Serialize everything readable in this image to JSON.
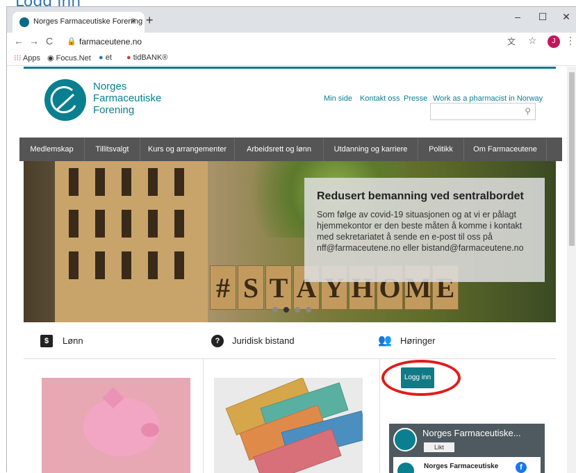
{
  "top_heading": "Logg inn",
  "browser": {
    "tab_title": "Norges Farmaceutiske Forening",
    "tab_close": "×",
    "new_tab": "+",
    "min": "–",
    "max": "☐",
    "close": "✕",
    "url": "farmaceutene.no",
    "profile_initial": "J",
    "bookmarks": [
      {
        "label": "Apps",
        "icon": "apps-grid-icon"
      },
      {
        "label": "Focus.Net",
        "icon": "globe-icon"
      },
      {
        "label": "et",
        "icon": "et-icon"
      },
      {
        "label": "tidBANK®",
        "icon": "tidbank-icon"
      }
    ]
  },
  "site": {
    "logo_lines": [
      "Norges",
      "Farmaceutiske",
      "Forening"
    ],
    "top_links": [
      "Min side",
      "Kontakt oss",
      "Presse",
      "Work as a pharmacist in Norway"
    ],
    "nav": [
      "Medlemskap",
      "Tillitsvalgt",
      "Kurs og arrangementer",
      "Arbeidsrett og lønn",
      "Utdanning og karriere",
      "Politikk",
      "Om Farmaceutene"
    ],
    "hero": {
      "title": "Redusert bemanning ved sentralbordet",
      "body": "Som følge av covid-19 situasjonen og at vi er pålagt hjemmekontor er den beste måten å komme i kontakt med sekretariatet å sende en e-post til oss på nff@farmaceutene.no eller bistand@farmaceutene.no",
      "blocks": [
        "#",
        "S",
        "T",
        "A",
        "Y",
        "H",
        "O",
        "M",
        "E"
      ]
    },
    "quick_links": [
      {
        "label": "Lønn",
        "icon": "money-icon"
      },
      {
        "label": "Juridisk bistand",
        "icon": "question-icon"
      },
      {
        "label": "Høringer",
        "icon": "people-icon"
      }
    ],
    "login_button": "Logg inn",
    "facebook": {
      "page_name": "Norges Farmaceutiske...",
      "like": "Likt",
      "card_name": "Norges Farmaceutiske",
      "fb_letter": "f"
    },
    "colors": {
      "teal": "#0a7f8f",
      "nav_bg": "#555555",
      "highlight": "#e01c1c"
    }
  }
}
